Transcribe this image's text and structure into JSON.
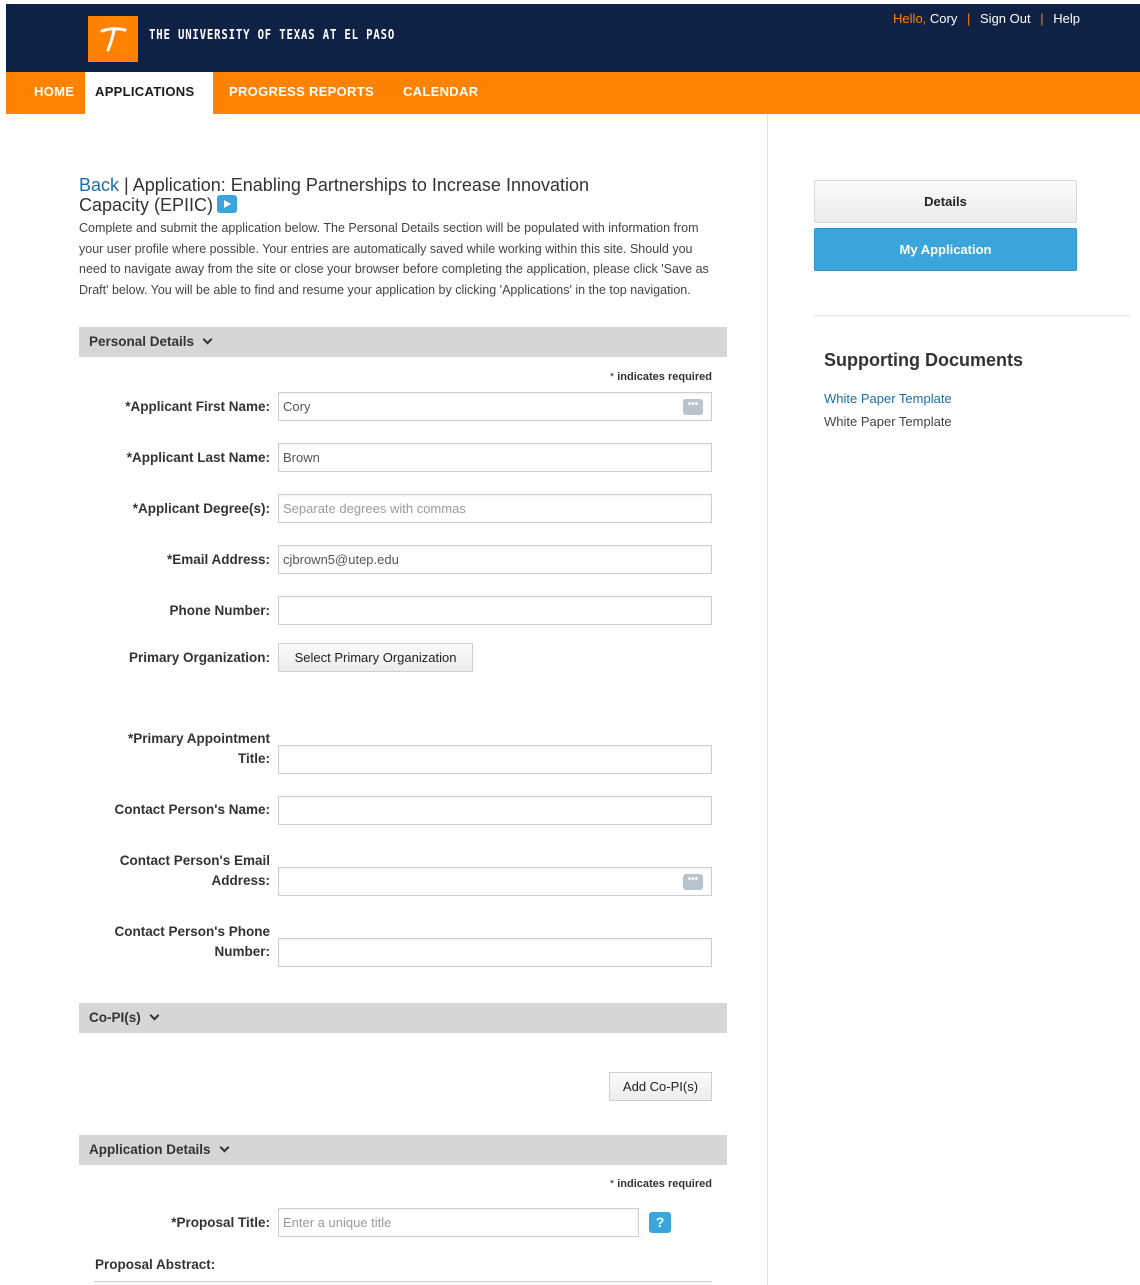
{
  "header": {
    "logo_letter": "T",
    "wordmark": "THE UNIVERSITY OF TEXAS AT EL PASO",
    "hello": "Hello,",
    "user_name": "Cory",
    "sign_out": "Sign Out",
    "help": "Help",
    "separator": "|"
  },
  "nav": {
    "home": "HOME",
    "applications": "APPLICATIONS",
    "progress_reports": "PROGRESS REPORTS",
    "calendar": "CALENDAR"
  },
  "page": {
    "back": "Back",
    "title_sep": " | ",
    "title": "Application: Enabling Partnerships to Increase Innovation Capacity (EPIIC)",
    "intro": "Complete and submit the application below. The Personal Details section will be populated with information from your user profile where possible. Your entries are automatically saved while working within this site. Should you need to navigate away from the site or close your browser before completing the application, please click 'Save as Draft' below. You will be able to find and resume your application by clicking 'Applications' in the top navigation."
  },
  "personal": {
    "header": "Personal Details",
    "required_star": "*",
    "required_note": "indicates required",
    "first_name_label": "*Applicant First Name:",
    "first_name_value": "Cory",
    "last_name_label": "*Applicant Last Name:",
    "last_name_value": "Brown",
    "degrees_label": "*Applicant Degree(s):",
    "degrees_placeholder": "Separate degrees with commas",
    "email_label": "*Email Address:",
    "email_value": "cjbrown5@utep.edu",
    "phone_label": "Phone Number:",
    "primary_org_label": "Primary Organization:",
    "primary_org_button": "Select Primary Organization",
    "appointment_label_1": "*Primary Appointment",
    "appointment_label_2": "Title:",
    "contact_name_label": "Contact Person's Name:",
    "contact_email_label_1": "Contact Person's Email",
    "contact_email_label_2": "Address:",
    "contact_phone_label_1": "Contact Person's Phone",
    "contact_phone_label_2": "Number:"
  },
  "copi": {
    "header": "Co-PI(s)",
    "add_button": "Add Co-PI(s)"
  },
  "app_details": {
    "header": "Application Details",
    "required_star": "*",
    "required_note": "indicates required",
    "proposal_title_label": "*Proposal Title:",
    "proposal_title_placeholder": "Enter a unique title",
    "help_glyph": "?",
    "abstract_label": "Proposal Abstract:"
  },
  "sidebar": {
    "details_button": "Details",
    "my_application_button": "My Application",
    "supporting_title": "Supporting Documents",
    "doc_link": "White Paper Template",
    "doc_text": "White Paper Template"
  },
  "icons": {
    "lookup": "lookup-dots-icon",
    "play": "play-icon",
    "chevron": "chevron-down-icon",
    "help": "help-icon"
  },
  "colors": {
    "navy": "#0f2245",
    "orange": "#ff8200",
    "blue": "#3aa5db",
    "link": "#1e6ea8"
  }
}
